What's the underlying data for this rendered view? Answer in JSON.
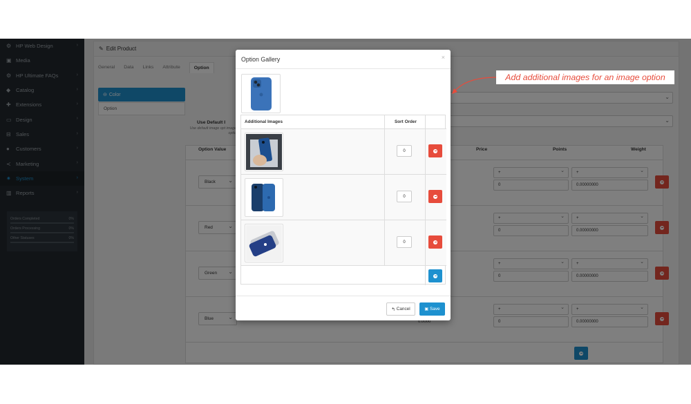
{
  "sidebar": {
    "items": [
      {
        "label": "HP Web Design",
        "icon": "cogs-icon",
        "chevron": "›"
      },
      {
        "label": "Media",
        "icon": "image-icon",
        "chevron": ""
      },
      {
        "label": "HP Ultimate FAQs",
        "icon": "cogs-icon",
        "chevron": "›"
      },
      {
        "label": "Catalog",
        "icon": "tag-icon",
        "chevron": "›"
      },
      {
        "label": "Extensions",
        "icon": "puzzle-icon",
        "chevron": "›"
      },
      {
        "label": "Design",
        "icon": "monitor-icon",
        "chevron": "›"
      },
      {
        "label": "Sales",
        "icon": "cart-icon",
        "chevron": "›"
      },
      {
        "label": "Customers",
        "icon": "user-icon",
        "chevron": "›"
      },
      {
        "label": "Marketing",
        "icon": "share-icon",
        "chevron": "›"
      },
      {
        "label": "System",
        "icon": "gear-icon",
        "chevron": "›"
      },
      {
        "label": "Reports",
        "icon": "bar-chart-icon",
        "chevron": "›"
      }
    ],
    "active_index": 9,
    "stats": [
      {
        "label": "Orders Completed",
        "value": "0%",
        "progress": 0
      },
      {
        "label": "Orders Processing",
        "value": "0%",
        "progress": 0
      },
      {
        "label": "Other Statuses",
        "value": "0%",
        "progress": 0
      }
    ]
  },
  "panel": {
    "title": "Edit Product",
    "tabs": [
      "General",
      "Data",
      "Links",
      "Attribute",
      "Option"
    ],
    "active_tab": "Option",
    "option_list": {
      "active": "Color",
      "next": "Option"
    },
    "use_default_label": "Use Default I",
    "use_default_help": "Use default image opt image optio",
    "columns": {
      "option_value": "Option Value",
      "price": "Price",
      "points": "Points",
      "weight": "Weight"
    },
    "rows": [
      {
        "value": "Black",
        "price": "",
        "points_sign": "+",
        "points": "0",
        "weight_sign": "+",
        "weight": "0.00000000"
      },
      {
        "value": "Red",
        "price": "",
        "points_sign": "+",
        "points": "0",
        "weight_sign": "+",
        "weight": "0.00000000"
      },
      {
        "value": "Green",
        "price": "",
        "points_sign": "+",
        "points": "0",
        "weight_sign": "+",
        "weight": "0.00000000"
      },
      {
        "value": "Blue",
        "price": "0.0000",
        "points_sign": "+",
        "points": "0",
        "weight_sign": "+",
        "weight": "0.00000000"
      }
    ]
  },
  "modal": {
    "title": "Option Gallery",
    "close": "×",
    "headers": {
      "images": "Additional Images",
      "sort": "Sort Order"
    },
    "images": [
      {
        "sort_order": "0"
      },
      {
        "sort_order": "0"
      },
      {
        "sort_order": "0"
      }
    ],
    "cancel_label": "Cancel",
    "save_label": "Save"
  },
  "annotation": {
    "text": "Add additional images for an image option"
  },
  "colors": {
    "primary": "#1e91cf",
    "danger": "#e74c3c",
    "sidebar": "#23292f",
    "phone_blue": "#2f6fb3"
  }
}
